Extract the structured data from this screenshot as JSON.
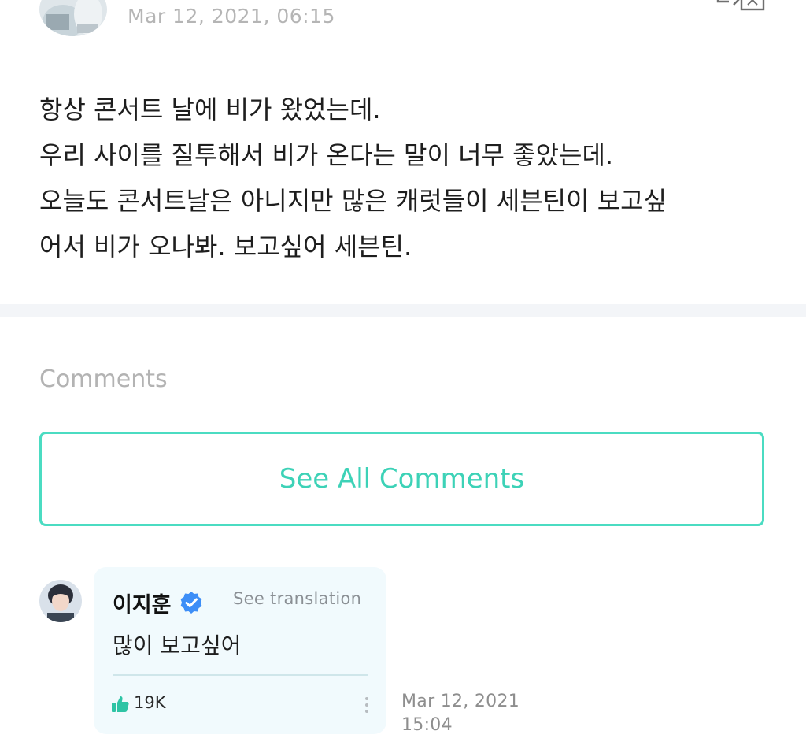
{
  "post": {
    "date": "Mar 12, 2021, 06:15",
    "lines": [
      "항상 콘서트 날에 비가 왔었는데.",
      "우리 사이를 질투해서 비가 온다는 말이 너무 좋았는데.",
      "오늘도 콘서트날은 아니지만 많은 캐럿들이 세븐틴이 보고싶",
      "어서 비가 오나봐. 보고싶어 세븐틴."
    ]
  },
  "icons": {
    "post_avatar": "avatar",
    "translate": "translate-icon",
    "verified": "verified-badge-icon",
    "like": "thumbs-up-icon",
    "more": "more-vertical-icon"
  },
  "colors": {
    "accent": "#3dd2b7",
    "accent_border": "#4bdcc2",
    "bubble_bg": "#f1fafd",
    "verified": "#3d8ef7",
    "like": "#2ec4a5"
  },
  "comments": {
    "heading": "Comments",
    "see_all_label": "See All Comments",
    "items": [
      {
        "author": "이지훈",
        "see_translation": "See translation",
        "text": "많이 보고싶어",
        "likes": "19K",
        "date_line1": "Mar 12, 2021",
        "date_line2": "15:04"
      }
    ]
  }
}
